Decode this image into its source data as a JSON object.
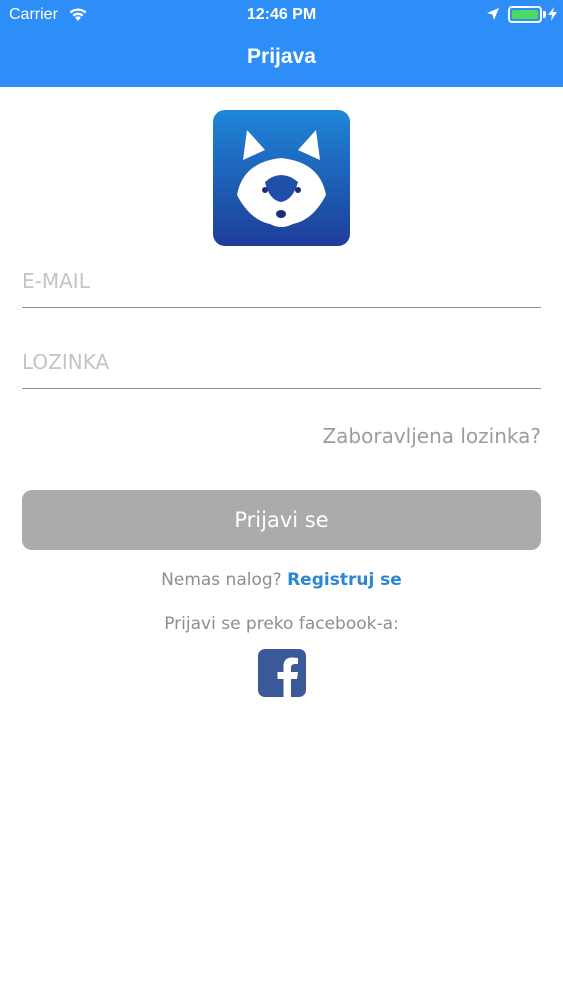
{
  "status_bar": {
    "carrier": "Carrier",
    "time": "12:46 PM",
    "icons": [
      "wifi-icon",
      "location-arrow-icon",
      "battery-icon",
      "charging-bolt-icon"
    ],
    "battery_color": "#4cd964"
  },
  "nav": {
    "title": "Prijava",
    "background": "#2d8ef7"
  },
  "logo": {
    "icon": "husky-logo-icon"
  },
  "form": {
    "email_placeholder": "E-MAIL",
    "email_value": "",
    "password_placeholder": "LOZINKA",
    "password_value": "",
    "forgot_label": "Zaboravljena lozinka?",
    "login_label": "Prijavi se",
    "login_button_color": "#ababad"
  },
  "signup": {
    "question": "Nemas nalog?",
    "link_label": "Registruj se",
    "link_color": "#2c86d6"
  },
  "facebook": {
    "prompt": "Prijavi se preko facebook-a:",
    "icon": "facebook-icon",
    "color": "#3b5998"
  }
}
